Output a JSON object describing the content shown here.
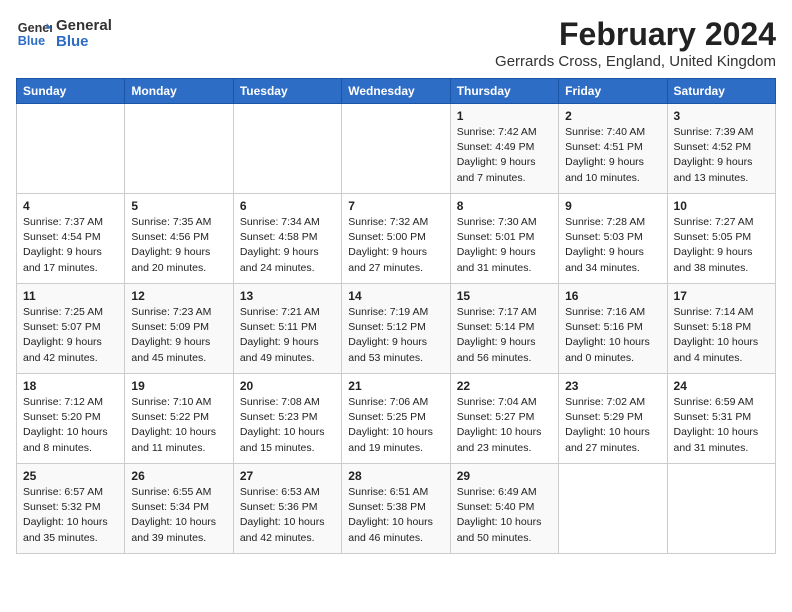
{
  "header": {
    "logo_line1": "General",
    "logo_line2": "Blue",
    "month_year": "February 2024",
    "location": "Gerrards Cross, England, United Kingdom"
  },
  "days_of_week": [
    "Sunday",
    "Monday",
    "Tuesday",
    "Wednesday",
    "Thursday",
    "Friday",
    "Saturday"
  ],
  "weeks": [
    [
      {
        "date": "",
        "info": ""
      },
      {
        "date": "",
        "info": ""
      },
      {
        "date": "",
        "info": ""
      },
      {
        "date": "",
        "info": ""
      },
      {
        "date": "1",
        "info": "Sunrise: 7:42 AM\nSunset: 4:49 PM\nDaylight: 9 hours\nand 7 minutes."
      },
      {
        "date": "2",
        "info": "Sunrise: 7:40 AM\nSunset: 4:51 PM\nDaylight: 9 hours\nand 10 minutes."
      },
      {
        "date": "3",
        "info": "Sunrise: 7:39 AM\nSunset: 4:52 PM\nDaylight: 9 hours\nand 13 minutes."
      }
    ],
    [
      {
        "date": "4",
        "info": "Sunrise: 7:37 AM\nSunset: 4:54 PM\nDaylight: 9 hours\nand 17 minutes."
      },
      {
        "date": "5",
        "info": "Sunrise: 7:35 AM\nSunset: 4:56 PM\nDaylight: 9 hours\nand 20 minutes."
      },
      {
        "date": "6",
        "info": "Sunrise: 7:34 AM\nSunset: 4:58 PM\nDaylight: 9 hours\nand 24 minutes."
      },
      {
        "date": "7",
        "info": "Sunrise: 7:32 AM\nSunset: 5:00 PM\nDaylight: 9 hours\nand 27 minutes."
      },
      {
        "date": "8",
        "info": "Sunrise: 7:30 AM\nSunset: 5:01 PM\nDaylight: 9 hours\nand 31 minutes."
      },
      {
        "date": "9",
        "info": "Sunrise: 7:28 AM\nSunset: 5:03 PM\nDaylight: 9 hours\nand 34 minutes."
      },
      {
        "date": "10",
        "info": "Sunrise: 7:27 AM\nSunset: 5:05 PM\nDaylight: 9 hours\nand 38 minutes."
      }
    ],
    [
      {
        "date": "11",
        "info": "Sunrise: 7:25 AM\nSunset: 5:07 PM\nDaylight: 9 hours\nand 42 minutes."
      },
      {
        "date": "12",
        "info": "Sunrise: 7:23 AM\nSunset: 5:09 PM\nDaylight: 9 hours\nand 45 minutes."
      },
      {
        "date": "13",
        "info": "Sunrise: 7:21 AM\nSunset: 5:11 PM\nDaylight: 9 hours\nand 49 minutes."
      },
      {
        "date": "14",
        "info": "Sunrise: 7:19 AM\nSunset: 5:12 PM\nDaylight: 9 hours\nand 53 minutes."
      },
      {
        "date": "15",
        "info": "Sunrise: 7:17 AM\nSunset: 5:14 PM\nDaylight: 9 hours\nand 56 minutes."
      },
      {
        "date": "16",
        "info": "Sunrise: 7:16 AM\nSunset: 5:16 PM\nDaylight: 10 hours\nand 0 minutes."
      },
      {
        "date": "17",
        "info": "Sunrise: 7:14 AM\nSunset: 5:18 PM\nDaylight: 10 hours\nand 4 minutes."
      }
    ],
    [
      {
        "date": "18",
        "info": "Sunrise: 7:12 AM\nSunset: 5:20 PM\nDaylight: 10 hours\nand 8 minutes."
      },
      {
        "date": "19",
        "info": "Sunrise: 7:10 AM\nSunset: 5:22 PM\nDaylight: 10 hours\nand 11 minutes."
      },
      {
        "date": "20",
        "info": "Sunrise: 7:08 AM\nSunset: 5:23 PM\nDaylight: 10 hours\nand 15 minutes."
      },
      {
        "date": "21",
        "info": "Sunrise: 7:06 AM\nSunset: 5:25 PM\nDaylight: 10 hours\nand 19 minutes."
      },
      {
        "date": "22",
        "info": "Sunrise: 7:04 AM\nSunset: 5:27 PM\nDaylight: 10 hours\nand 23 minutes."
      },
      {
        "date": "23",
        "info": "Sunrise: 7:02 AM\nSunset: 5:29 PM\nDaylight: 10 hours\nand 27 minutes."
      },
      {
        "date": "24",
        "info": "Sunrise: 6:59 AM\nSunset: 5:31 PM\nDaylight: 10 hours\nand 31 minutes."
      }
    ],
    [
      {
        "date": "25",
        "info": "Sunrise: 6:57 AM\nSunset: 5:32 PM\nDaylight: 10 hours\nand 35 minutes."
      },
      {
        "date": "26",
        "info": "Sunrise: 6:55 AM\nSunset: 5:34 PM\nDaylight: 10 hours\nand 39 minutes."
      },
      {
        "date": "27",
        "info": "Sunrise: 6:53 AM\nSunset: 5:36 PM\nDaylight: 10 hours\nand 42 minutes."
      },
      {
        "date": "28",
        "info": "Sunrise: 6:51 AM\nSunset: 5:38 PM\nDaylight: 10 hours\nand 46 minutes."
      },
      {
        "date": "29",
        "info": "Sunrise: 6:49 AM\nSunset: 5:40 PM\nDaylight: 10 hours\nand 50 minutes."
      },
      {
        "date": "",
        "info": ""
      },
      {
        "date": "",
        "info": ""
      }
    ]
  ]
}
